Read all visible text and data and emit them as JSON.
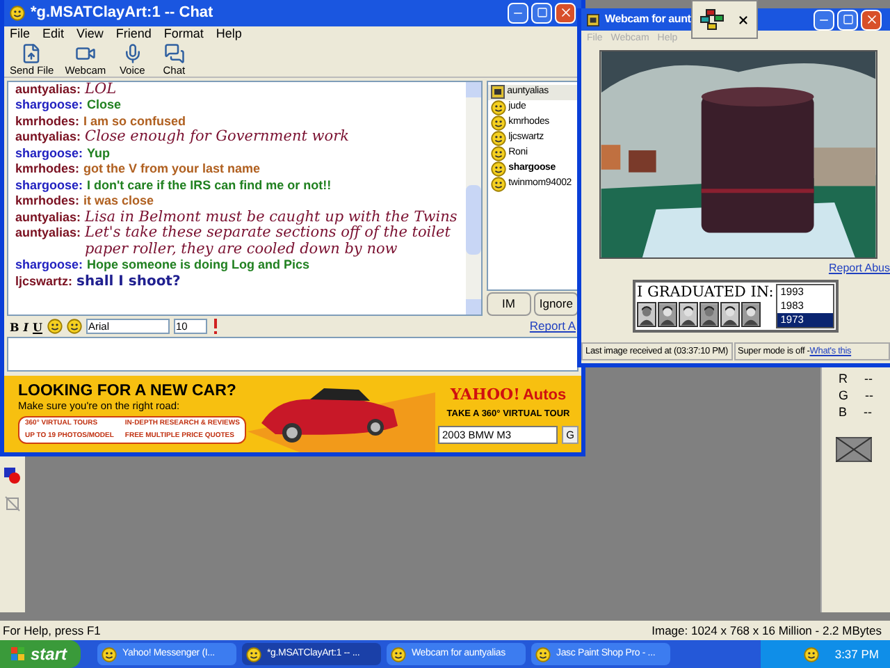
{
  "paint_shop": {
    "status_help": "For Help, press F1",
    "status_image": "Image:  1024 x 768 x 16 Million - 2.2 MBytes",
    "channels": [
      {
        "label": "R",
        "value": "--"
      },
      {
        "label": "G",
        "value": "--"
      },
      {
        "label": "B",
        "value": "--"
      }
    ]
  },
  "chat_window": {
    "title": "*g.MSATClayArt:1 -- Chat",
    "menu": [
      "File",
      "Edit",
      "View",
      "Friend",
      "Format",
      "Help"
    ],
    "toolbar": [
      {
        "label": "Send File",
        "kind": "file"
      },
      {
        "label": "Webcam",
        "kind": "webcam"
      },
      {
        "label": "Voice",
        "kind": "voice"
      },
      {
        "label": "Chat",
        "kind": "chat"
      }
    ],
    "messages": [
      {
        "user": {
          "name": "auntyalias:",
          "color": "#7a1020"
        },
        "text": "LOL",
        "color": "#7a1030",
        "kind": "script"
      },
      {
        "user": {
          "name": "shargoose:",
          "color": "#2020c0"
        },
        "text": "Close",
        "color": "#208020",
        "kind": "plain"
      },
      {
        "user": {
          "name": "kmrhodes:",
          "color": "#7a1020"
        },
        "text": "I am so confused",
        "color": "#b06020",
        "kind": "plain"
      },
      {
        "user": {
          "name": "auntyalias:",
          "color": "#7a1020"
        },
        "text": "Close enough for Government work",
        "color": "#7a1030",
        "kind": "script"
      },
      {
        "user": {
          "name": "shargoose:",
          "color": "#2020c0"
        },
        "text": "Yup",
        "color": "#208020",
        "kind": "plain"
      },
      {
        "user": {
          "name": "kmrhodes:",
          "color": "#7a1020"
        },
        "text": "got the V from your last name",
        "color": "#b06020",
        "kind": "plain"
      },
      {
        "user": {
          "name": "shargoose:",
          "color": "#2020c0"
        },
        "text": "I don't care if the IRS can find me or not!!",
        "color": "#208020",
        "kind": "plain"
      },
      {
        "user": {
          "name": "kmrhodes:",
          "color": "#7a1020"
        },
        "text": "it was close",
        "color": "#b06020",
        "kind": "plain"
      },
      {
        "user": {
          "name": "auntyalias:",
          "color": "#7a1020"
        },
        "text": "Lisa in Belmont must be caught up with the Twins",
        "color": "#7a1030",
        "kind": "script"
      },
      {
        "user": {
          "name": "auntyalias:",
          "color": "#7a1020"
        },
        "text": "Let's take these separate sections off of the toilet paper roller, they are cooled down by now",
        "color": "#7a1030",
        "kind": "script"
      },
      {
        "user": {
          "name": "shargoose:",
          "color": "#2020c0"
        },
        "text": "Hope someone is doing Log and Pics",
        "color": "#208020",
        "kind": "plain"
      },
      {
        "user": {
          "name": "ljcswartz:",
          "color": "#7a1020"
        },
        "text": "shall I shoot?",
        "color": "#202090",
        "kind": "comic"
      }
    ],
    "format_buttons": [
      {
        "label": "B",
        "kind": "bold"
      },
      {
        "label": "I",
        "kind": "italic"
      },
      {
        "label": "U",
        "kind": "underline"
      }
    ],
    "users": [
      {
        "name": "auntyalias",
        "selected": true,
        "bold": false,
        "kind": "webcam"
      },
      {
        "name": "jude",
        "selected": false,
        "bold": false,
        "kind": "smiley"
      },
      {
        "name": "kmrhodes",
        "selected": false,
        "bold": false,
        "kind": "smiley"
      },
      {
        "name": "ljcswartz",
        "selected": false,
        "bold": false,
        "kind": "smiley"
      },
      {
        "name": "Roni",
        "selected": false,
        "bold": false,
        "kind": "smiley"
      },
      {
        "name": "shargoose",
        "selected": false,
        "bold": true,
        "kind": "smiley"
      },
      {
        "name": "twinmom94002",
        "selected": false,
        "bold": false,
        "kind": "smiley"
      }
    ],
    "buttons": [
      "IM",
      "Ignore"
    ],
    "report_link": "Report A",
    "font": "Arial",
    "size": "10",
    "ad": {
      "headline": "LOOKING FOR A NEW CAR?",
      "subline": "Make sure you're on the right road:",
      "features": [
        "360° VIRTUAL TOURS",
        "IN-DEPTH RESEARCH & REVIEWS",
        "UP TO 19 PHOTOS/MODEL",
        "FREE MULTIPLE PRICE QUOTES"
      ],
      "brand": "YAHOO!",
      "brand_suffix": "Autos",
      "tagline": "TAKE A 360° VIRTUAL TOUR",
      "model": "2003 BMW M3",
      "go": "G"
    }
  },
  "webcam_window": {
    "title": "Webcam for aunt",
    "menu": [
      {
        "label": "File",
        "disabled": true
      },
      {
        "label": "Webcam",
        "disabled": true
      },
      {
        "label": "Help",
        "disabled": true
      }
    ],
    "report_link": "Report Abus",
    "ad": {
      "headline": "I GRADUATED IN:",
      "years": [
        {
          "label": "1993",
          "selected": false
        },
        {
          "label": "1983",
          "selected": false
        },
        {
          "label": "1973",
          "selected": true
        }
      ]
    },
    "status": "Last image received at (03:37:10 PM)",
    "mode": "Super mode is off - ",
    "mode_link": "What's this"
  },
  "taskbar": {
    "start": "start",
    "tasks": [
      {
        "label": "Yahoo! Messenger (I...",
        "selected": false
      },
      {
        "label": "*g.MSATClayArt:1 -- ...",
        "selected": true
      },
      {
        "label": "Webcam for auntyalias",
        "selected": false
      },
      {
        "label": "Jasc Paint Shop Pro - ...",
        "selected": false
      }
    ],
    "clock": "3:37 PM"
  }
}
